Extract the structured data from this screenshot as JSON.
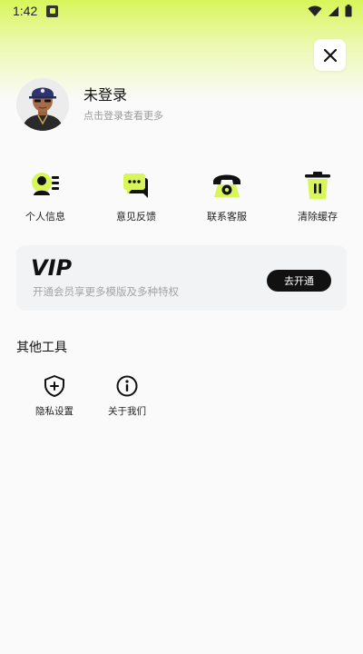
{
  "status_bar": {
    "time": "1:42"
  },
  "profile": {
    "name": "未登录",
    "subtitle": "点击登录查看更多"
  },
  "quick_actions": [
    {
      "label": "个人信息",
      "icon": "person-info-icon"
    },
    {
      "label": "意见反馈",
      "icon": "feedback-icon"
    },
    {
      "label": "联系客服",
      "icon": "phone-icon"
    },
    {
      "label": "清除缓存",
      "icon": "trash-icon"
    }
  ],
  "vip": {
    "logo_text": "VIP",
    "description": "开通会员享更多模版及多种特权",
    "button_label": "去开通"
  },
  "tools": {
    "title": "其他工具",
    "items": [
      {
        "label": "隐私设置",
        "icon": "shield-icon"
      },
      {
        "label": "关于我们",
        "icon": "info-icon"
      }
    ]
  },
  "colors": {
    "accent": "#D8F55A",
    "dark": "#111111",
    "background": "#FAFAFA",
    "card": "#F2F3F5"
  }
}
